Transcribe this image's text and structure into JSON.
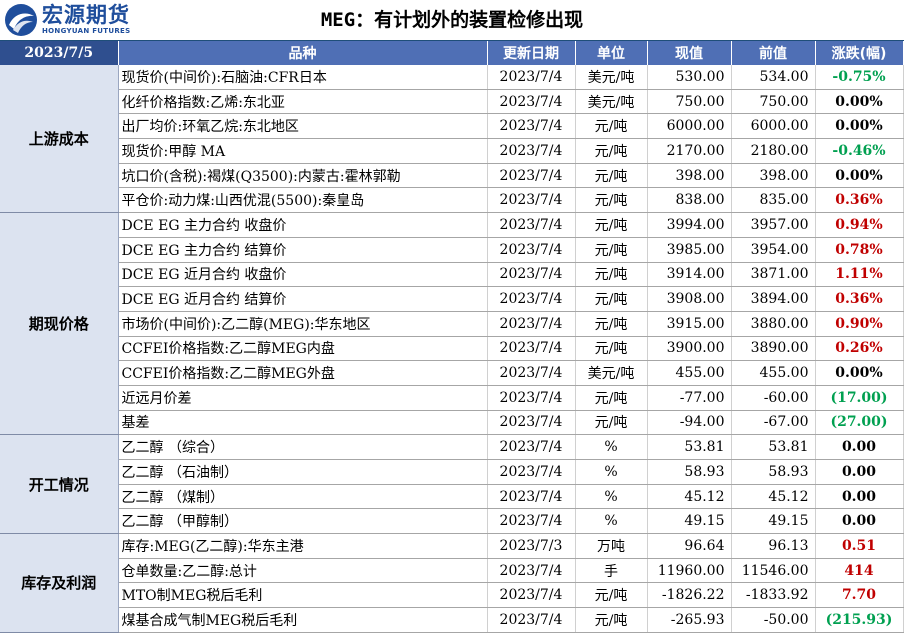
{
  "brand": {
    "name_cn": "宏源期货",
    "name_en": "HONGYUAN FUTURES"
  },
  "title": "MEG：有计划外的装置检修出现",
  "date": "2023/7/5",
  "columns": [
    "品种",
    "更新日期",
    "单位",
    "现值",
    "前值",
    "涨跌(幅)"
  ],
  "colors": {
    "up": "#c00000",
    "down": "#00a050",
    "header_bg": "#4f6fb5",
    "category_bg": "#dce3f0",
    "brand": "#1f4e9c"
  },
  "sections": [
    {
      "category": "上游成本",
      "rows": [
        {
          "name": "现货价(中间价):石脑油:CFR日本",
          "date": "2023/7/4",
          "unit": "美元/吨",
          "current": "530.00",
          "previous": "534.00",
          "change": "-0.75%",
          "dir": "down"
        },
        {
          "name": "化纤价格指数:乙烯:东北亚",
          "date": "2023/7/4",
          "unit": "美元/吨",
          "current": "750.00",
          "previous": "750.00",
          "change": "0.00%",
          "dir": "flat"
        },
        {
          "name": "出厂均价:环氧乙烷:东北地区",
          "date": "2023/7/4",
          "unit": "元/吨",
          "current": "6000.00",
          "previous": "6000.00",
          "change": "0.00%",
          "dir": "flat"
        },
        {
          "name": "现货价:甲醇 MA",
          "date": "2023/7/4",
          "unit": "元/吨",
          "current": "2170.00",
          "previous": "2180.00",
          "change": "-0.46%",
          "dir": "down"
        },
        {
          "name": "坑口价(含税):褐煤(Q3500):内蒙古:霍林郭勒",
          "date": "2023/7/4",
          "unit": "元/吨",
          "current": "398.00",
          "previous": "398.00",
          "change": "0.00%",
          "dir": "flat"
        },
        {
          "name": "平仓价:动力煤:山西优混(5500):秦皇岛",
          "date": "2023/7/4",
          "unit": "元/吨",
          "current": "838.00",
          "previous": "835.00",
          "change": "0.36%",
          "dir": "up"
        }
      ]
    },
    {
      "category": "期现价格",
      "rows": [
        {
          "name": "DCE EG 主力合约 收盘价",
          "date": "2023/7/4",
          "unit": "元/吨",
          "current": "3994.00",
          "previous": "3957.00",
          "change": "0.94%",
          "dir": "up"
        },
        {
          "name": "DCE EG 主力合约 结算价",
          "date": "2023/7/4",
          "unit": "元/吨",
          "current": "3985.00",
          "previous": "3954.00",
          "change": "0.78%",
          "dir": "up"
        },
        {
          "name": "DCE EG 近月合约 收盘价",
          "date": "2023/7/4",
          "unit": "元/吨",
          "current": "3914.00",
          "previous": "3871.00",
          "change": "1.11%",
          "dir": "up"
        },
        {
          "name": "DCE EG 近月合约 结算价",
          "date": "2023/7/4",
          "unit": "元/吨",
          "current": "3908.00",
          "previous": "3894.00",
          "change": "0.36%",
          "dir": "up"
        },
        {
          "name": "市场价(中间价):乙二醇(MEG):华东地区",
          "date": "2023/7/4",
          "unit": "元/吨",
          "current": "3915.00",
          "previous": "3880.00",
          "change": "0.90%",
          "dir": "up"
        },
        {
          "name": "CCFEI价格指数:乙二醇MEG内盘",
          "date": "2023/7/4",
          "unit": "元/吨",
          "current": "3900.00",
          "previous": "3890.00",
          "change": "0.26%",
          "dir": "up"
        },
        {
          "name": "CCFEI价格指数:乙二醇MEG外盘",
          "date": "2023/7/4",
          "unit": "美元/吨",
          "current": "455.00",
          "previous": "455.00",
          "change": "0.00%",
          "dir": "flat"
        },
        {
          "name": "近远月价差",
          "date": "2023/7/4",
          "unit": "元/吨",
          "current": "-77.00",
          "previous": "-60.00",
          "change": "(17.00)",
          "dir": "down"
        },
        {
          "name": "基差",
          "date": "2023/7/4",
          "unit": "元/吨",
          "current": "-94.00",
          "previous": "-67.00",
          "change": "(27.00)",
          "dir": "down"
        }
      ]
    },
    {
      "category": "开工情况",
      "rows": [
        {
          "name": "乙二醇 （综合）",
          "date": "2023/7/4",
          "unit": "%",
          "current": "53.81",
          "previous": "53.81",
          "change": "0.00",
          "dir": "flat"
        },
        {
          "name": "乙二醇 （石油制）",
          "date": "2023/7/4",
          "unit": "%",
          "current": "58.93",
          "previous": "58.93",
          "change": "0.00",
          "dir": "flat"
        },
        {
          "name": "乙二醇 （煤制）",
          "date": "2023/7/4",
          "unit": "%",
          "current": "45.12",
          "previous": "45.12",
          "change": "0.00",
          "dir": "flat"
        },
        {
          "name": "乙二醇 （甲醇制）",
          "date": "2023/7/4",
          "unit": "%",
          "current": "49.15",
          "previous": "49.15",
          "change": "0.00",
          "dir": "flat"
        }
      ]
    },
    {
      "category": "库存及利润",
      "rows": [
        {
          "name": "库存:MEG(乙二醇):华东主港",
          "date": "2023/7/3",
          "unit": "万吨",
          "current": "96.64",
          "previous": "96.13",
          "change": "0.51",
          "dir": "up"
        },
        {
          "name": "仓单数量:乙二醇:总计",
          "date": "2023/7/4",
          "unit": "手",
          "current": "11960.00",
          "previous": "11546.00",
          "change": "414",
          "dir": "up"
        },
        {
          "name": "MTO制MEG税后毛利",
          "date": "2023/7/4",
          "unit": "元/吨",
          "current": "-1826.22",
          "previous": "-1833.92",
          "change": "7.70",
          "dir": "up"
        },
        {
          "name": "煤基合成气制MEG税后毛利",
          "date": "2023/7/4",
          "unit": "元/吨",
          "current": "-265.93",
          "previous": "-50.00",
          "change": "(215.93)",
          "dir": "down"
        }
      ]
    }
  ]
}
